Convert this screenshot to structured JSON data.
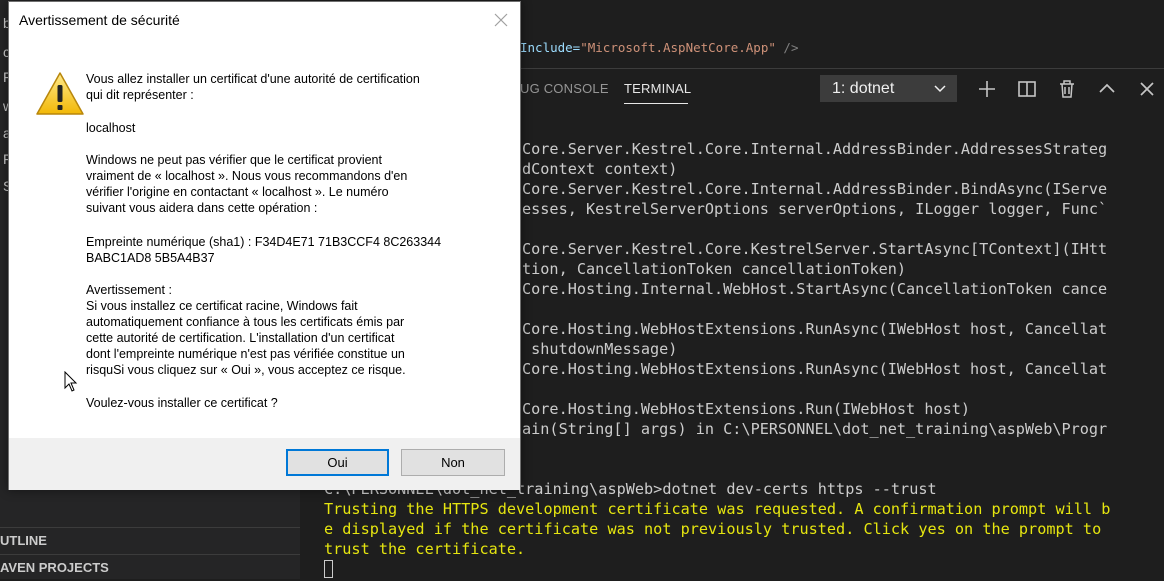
{
  "sidebar": {
    "letters": [
      "b",
      "c",
      "F",
      "w",
      "a",
      "F",
      "S"
    ],
    "outline_label": "UTLINE",
    "maven_label": "AVEN PROJECTS"
  },
  "editor": {
    "attr_fragment": "Include=",
    "value_fragment": "\"Microsoft.AspNetCore.App\"",
    "close_fragment": " />"
  },
  "panel": {
    "debug_tab_partial": "UG CONSOLE",
    "terminal_tab": "TERMINAL",
    "terminal_select_value": "1: dotnet",
    "icons": [
      "plus-icon",
      "split-icon",
      "trash-icon",
      "chevron-up-icon",
      "close-icon"
    ]
  },
  "terminal": {
    "trace_lines": [
      "Core.Server.Kestrel.Core.Internal.AddressBinder.AddressesStrateg",
      "dContext context)",
      "Core.Server.Kestrel.Core.Internal.AddressBinder.BindAsync(IServe",
      "esses, KestrelServerOptions serverOptions, ILogger logger, Func`",
      "",
      "Core.Server.Kestrel.Core.KestrelServer.StartAsync[TContext](IHtt",
      "tion, CancellationToken cancellationToken)",
      "Core.Hosting.Internal.WebHost.StartAsync(CancellationToken cance",
      "",
      "Core.Hosting.WebHostExtensions.RunAsync(IWebHost host, Cancellat",
      " shutdownMessage)",
      "Core.Hosting.WebHostExtensions.RunAsync(IWebHost host, Cancellat",
      "",
      "Core.Hosting.WebHostExtensions.Run(IWebHost host)",
      "ain(String[] args) in C:\\PERSONNEL\\dot_net_training\\aspWeb\\Progr"
    ],
    "prompt_line": "C:\\PERSONNEL\\dot_net_training\\aspWeb>dotnet dev-certs https --trust",
    "yellow_lines": [
      "Trusting the HTTPS development certificate was requested. A confirmation prompt will b",
      "e displayed if the certificate was not previously trusted. Click yes on the prompt to",
      "trust the certificate."
    ]
  },
  "dialog": {
    "title": "Avertissement de sécurité",
    "intro_line1": "Vous allez installer un certificat d'une autorité de certification",
    "intro_line2": "qui dit représenter :",
    "host": "localhost",
    "para_lines": [
      "Windows ne peut pas vérifier que le certificat provient",
      "vraiment de « localhost ». Nous vous recommandons d'en",
      "vérifier l'origine en contactant « localhost ». Le numéro",
      "suivant vous aidera dans cette opération :"
    ],
    "thumbprint_line1": "Empreinte numérique (sha1) : F34D4E71 71B3CCF4 8C263344",
    "thumbprint_line2": "BABC1AD8 5B5A4B37",
    "warning_lines": [
      "Avertissement :",
      "Si vous installez ce certificat racine, Windows fait",
      "automatiquement confiance à tous les certificats émis par",
      "cette autorité de certification. L'installation d'un certificat",
      "dont l'empreinte numérique n'est pas vérifiée constitue un",
      "risquSi vous cliquez sur « Oui », vous acceptez ce risque."
    ],
    "question": "Voulez-vous installer ce certificat ?",
    "yes_label": "Oui",
    "no_label": "Non"
  },
  "colors": {
    "terminal_yellow": "#e5e510",
    "focus_blue": "#0078d7",
    "vscode_bg": "#1e1e1e",
    "sidebar_bg": "#252526"
  }
}
